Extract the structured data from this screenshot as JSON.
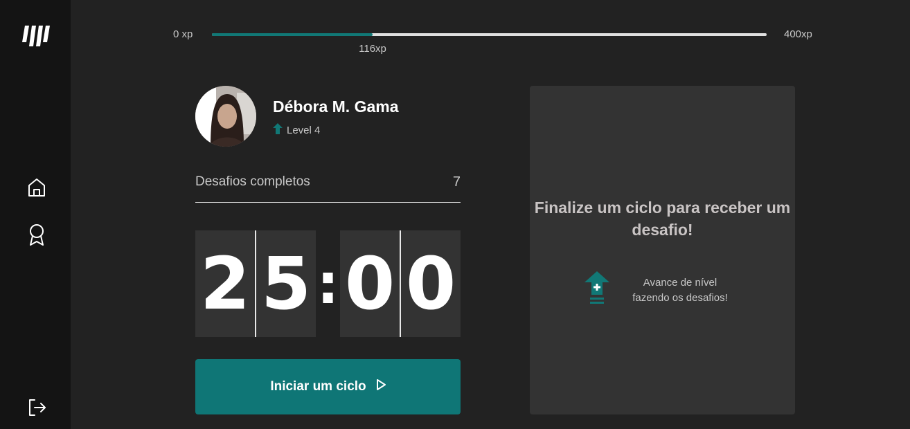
{
  "xp": {
    "min_label": "0 xp",
    "max_label": "400xp",
    "current_label": "116xp",
    "current": 116,
    "max": 400
  },
  "profile": {
    "name": "Débora M. Gama",
    "level_label": "Level 4"
  },
  "challenges": {
    "label": "Desafios completos",
    "count": "7"
  },
  "countdown": {
    "minute_left": "2",
    "minute_right": "5",
    "separator": ":",
    "second_left": "0",
    "second_right": "0"
  },
  "start_button": {
    "label": "Iniciar um ciclo"
  },
  "challenge_panel": {
    "title": "Finalize um ciclo para receber um desafio!",
    "hint": "Avance de nível fazendo os desafios!"
  },
  "colors": {
    "accent": "#0f7676",
    "background": "#222222",
    "sidebar": "#141414",
    "card": "#333333"
  },
  "icons": {
    "logo": "logo-icon",
    "home": "home-icon",
    "award": "award-icon",
    "logout": "logout-icon",
    "level": "level-up-icon",
    "play": "play-icon"
  }
}
